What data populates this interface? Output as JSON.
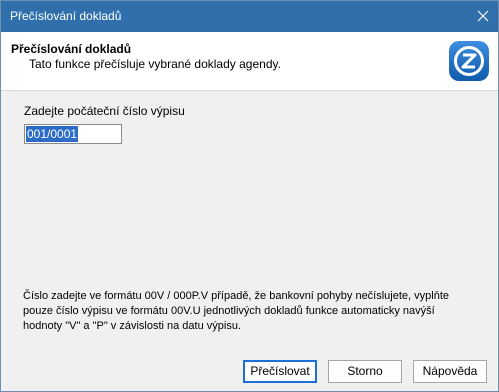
{
  "window": {
    "title": "Přečíslování dokladů"
  },
  "header": {
    "title": "Přečíslování dokladů",
    "subtitle": "Tato funkce přečísluje vybrané doklady agendy."
  },
  "form": {
    "start_label": "Zadejte počáteční číslo výpisu",
    "start_value": "001/0001"
  },
  "info_text": "Číslo zadejte ve formátu 00V / 000P.V případě, že bankovní pohyby nečíslujete, vyplňte pouze číslo výpisu ve formátu 00V.U jednotlivých dokladů funkce automaticky navýší hodnoty \"V\" a \"P\" v závislosti na datu výpisu.",
  "buttons": {
    "renumber": "Přečíslovat",
    "cancel": "Storno",
    "help": "Nápověda"
  },
  "colors": {
    "titlebar": "#2f6fac",
    "selection": "#2d6cc6",
    "logo": "#1b6fc4"
  },
  "icons": {
    "close": "close-icon",
    "logo": "app-logo-icon"
  }
}
